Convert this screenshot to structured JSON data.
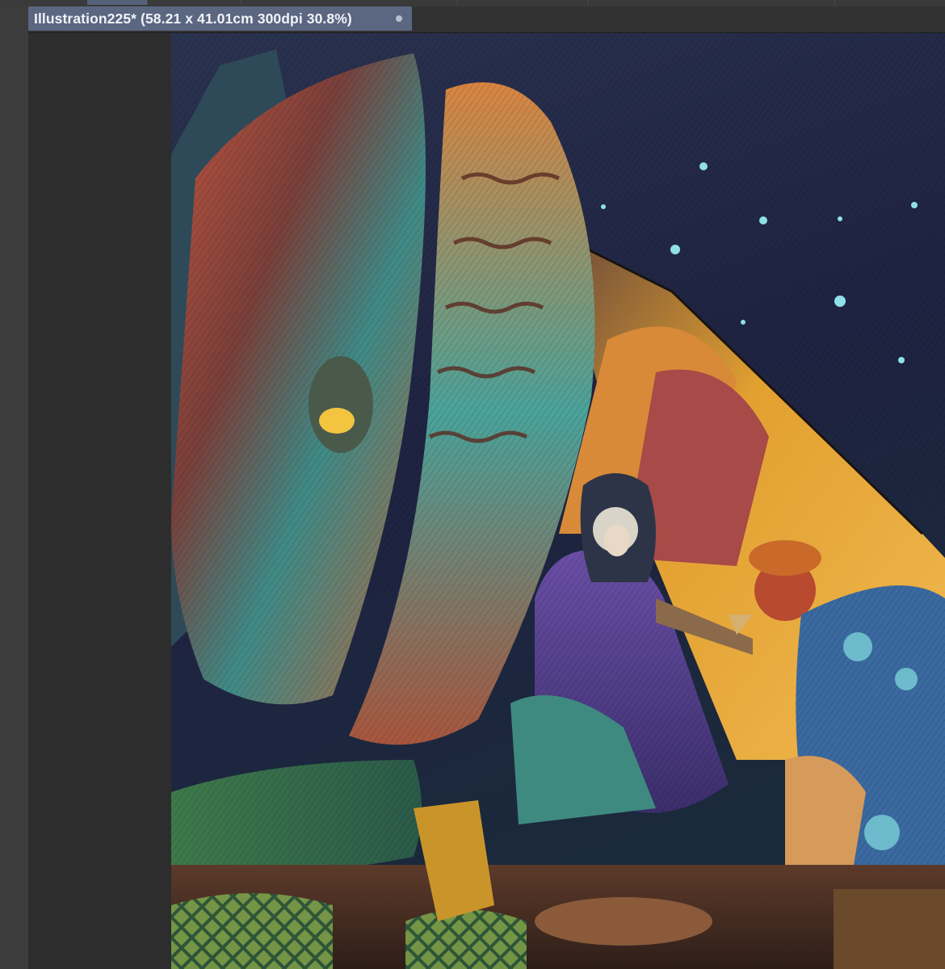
{
  "document_tab": {
    "title": "Illustration225* (58.21 x 41.01cm 300dpi 30.8%)"
  },
  "colors": {
    "tab_active": "#5b6781",
    "workspace": "#2d2d2d",
    "night_sky": "#1c1f3a",
    "star": "#8fe0e8"
  },
  "icons": {
    "modified_indicator": "unsaved-dot-icon"
  }
}
